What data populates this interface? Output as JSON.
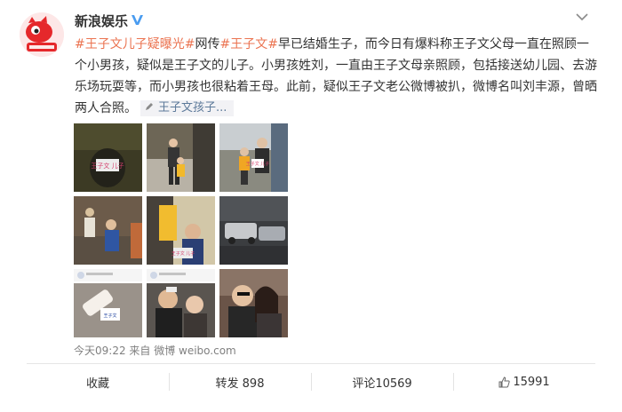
{
  "post": {
    "author": "新浪娱乐",
    "text_segments": [
      {
        "text": "#王子文儿子疑曝光#",
        "kind": "tag"
      },
      {
        "text": "网传",
        "kind": "plain"
      },
      {
        "text": "#王子文#",
        "kind": "tag"
      },
      {
        "text": "早已结婚生子，而今日有爆料称王子文父母一直在照顾一个小男孩，疑似是王子文的儿子。小男孩姓刘，一直由王子文母亲照顾，包括接送幼儿园、去游乐场玩耍等，而小男孩也很粘着王母。此前，疑似王子文老公微博被扒，微博名叫刘丰源，曾晒两人合照。",
        "kind": "plain"
      }
    ],
    "link_chip": "王子文孩子...",
    "photo_captions": [
      "王子文 儿子",
      "王子文 儿子",
      "王子文"
    ],
    "meta_time": "今天09:22 来自 微博 weibo.com"
  },
  "actions": {
    "favorite": "收藏",
    "repost": "转发 898",
    "comment": "评论10569",
    "like": "15991"
  },
  "colors": {
    "accent": "#eb7350",
    "link_chip": "#5d7a9a",
    "meta": "#808080"
  },
  "icons": [
    "avatar-logo-icon",
    "verified-v-icon",
    "chevron-down-icon",
    "pen-link-icon",
    "thumbs-up-icon"
  ]
}
